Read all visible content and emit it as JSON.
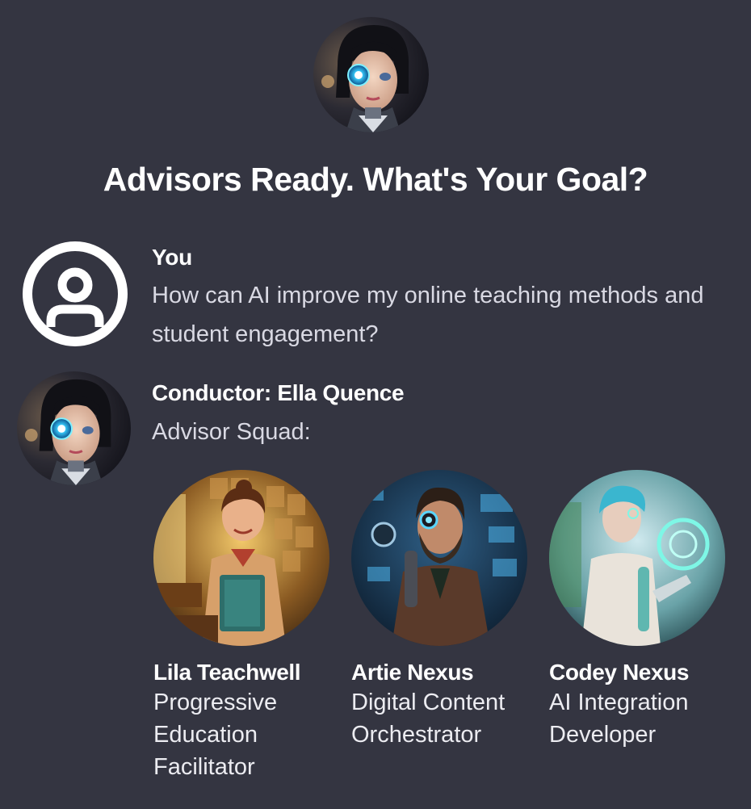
{
  "header": {
    "avatar_icon": "robot-girl-avatar",
    "title": "Advisors Ready. What's Your Goal?"
  },
  "messages": [
    {
      "author": "You",
      "avatar_icon": "user-circle-icon",
      "text": "How can AI improve my online teaching methods and student engagement?"
    },
    {
      "author": "Conductor: Ella Quence",
      "avatar_icon": "robot-girl-avatar",
      "text": "Advisor Squad:"
    }
  ],
  "advisors": [
    {
      "name": "Lila Teachwell",
      "role": "Progressive Education Facilitator",
      "accent": "#d8a23a"
    },
    {
      "name": "Artie Nexus",
      "role": "Digital Content Orchestrator",
      "accent": "#3aa3d6"
    },
    {
      "name": "Codey Nexus",
      "role": "AI Integration Developer",
      "accent": "#4fd9c9"
    }
  ],
  "colors": {
    "background": "#343541",
    "text": "#ececf1"
  }
}
